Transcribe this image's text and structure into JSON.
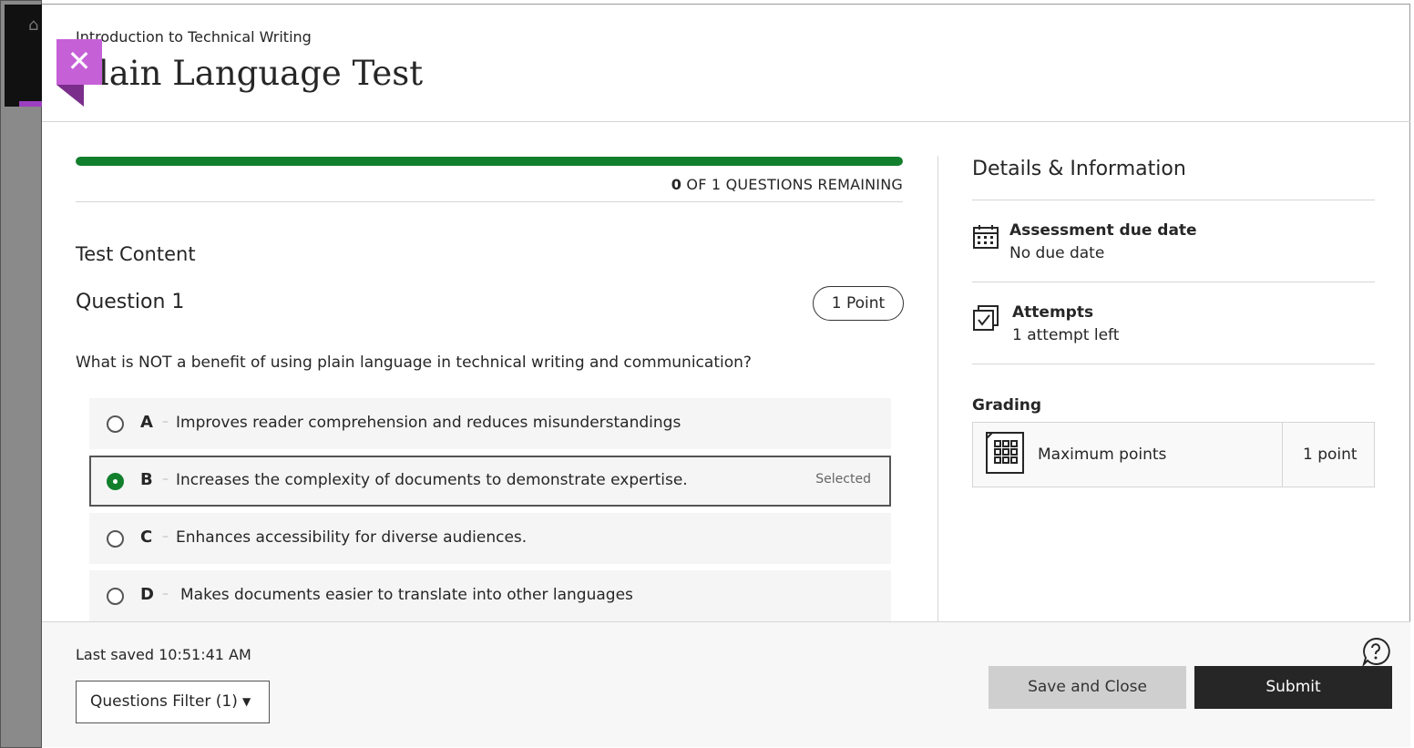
{
  "header": {
    "course_name": "Introduction to Technical Writing",
    "title": "Plain Language Test",
    "close_icon": "close-icon"
  },
  "progress": {
    "answered_fraction": 1.0,
    "remaining_count": "0",
    "remaining_suffix": "OF 1 QUESTIONS REMAINING",
    "bar_color": "#127f2d"
  },
  "content": {
    "section_label": "Test Content",
    "question": {
      "title": "Question 1",
      "points": "1 Point",
      "text": "What is NOT a benefit of using plain language in technical writing and communication?",
      "options": [
        {
          "letter": "A",
          "text": "Improves reader comprehension and reduces misunderstandings",
          "selected": false
        },
        {
          "letter": "B",
          "text": "Increases the complexity of documents to demonstrate expertise.",
          "selected": true,
          "selected_label": "Selected"
        },
        {
          "letter": "C",
          "text": "Enhances accessibility for diverse audiences.",
          "selected": false
        },
        {
          "letter": "D",
          "text": "Makes documents easier to translate into other languages",
          "selected": false
        }
      ]
    }
  },
  "sidebar": {
    "title": "Details & Information",
    "due_date": {
      "icon": "calendar-icon",
      "heading": "Assessment due date",
      "value": "No due date"
    },
    "attempts": {
      "icon": "checkbox-stack-icon",
      "heading": "Attempts",
      "value": "1 attempt left"
    },
    "grading": {
      "label": "Grading",
      "icon": "calculator-icon",
      "item_label": "Maximum points",
      "item_value": "1 point"
    }
  },
  "footer": {
    "last_saved": "Last saved 10:51:41 AM",
    "filter_label": "Questions Filter (1)",
    "filter_caret": "▼",
    "help_icon": "help-icon",
    "save_close_label": "Save and Close",
    "submit_label": "Submit"
  },
  "colors": {
    "accent_purple": "#c660d7",
    "success_green": "#127f2d",
    "submit_bg": "#262626"
  }
}
